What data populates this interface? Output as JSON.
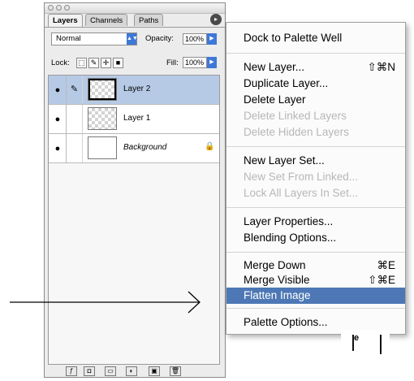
{
  "palette": {
    "tabs": [
      "Layers",
      "Channels",
      "Paths"
    ],
    "menu_button": "▸",
    "blend_mode": "Normal",
    "opacity_label": "Opacity:",
    "opacity_value": "100%",
    "lock_label": "Lock:",
    "fill_label": "Fill:",
    "fill_value": "100%",
    "layers": [
      {
        "name": "Layer 2",
        "selected": true
      },
      {
        "name": "Layer 1",
        "selected": false
      },
      {
        "name": "Background",
        "selected": false
      }
    ]
  },
  "menu": {
    "items": [
      {
        "label": "Dock to Palette Well",
        "shortcut": "",
        "disabled": false
      },
      {
        "label": "New Layer...",
        "shortcut": "⇧⌘N",
        "disabled": false
      },
      {
        "label": "Duplicate Layer...",
        "shortcut": "",
        "disabled": false
      },
      {
        "label": "Delete Layer",
        "shortcut": "",
        "disabled": false
      },
      {
        "label": "Delete Linked Layers",
        "shortcut": "",
        "disabled": true
      },
      {
        "label": "Delete Hidden Layers",
        "shortcut": "",
        "disabled": true
      },
      {
        "label": "New Layer Set...",
        "shortcut": "",
        "disabled": false
      },
      {
        "label": "New Set From Linked...",
        "shortcut": "",
        "disabled": true
      },
      {
        "label": "Lock All Layers In Set...",
        "shortcut": "",
        "disabled": true
      },
      {
        "label": "Layer Properties...",
        "shortcut": "",
        "disabled": false
      },
      {
        "label": "Blending Options...",
        "shortcut": "",
        "disabled": false
      },
      {
        "label": "Merge Down",
        "shortcut": "⌘E",
        "disabled": false
      },
      {
        "label": "Merge Visible",
        "shortcut": "⇧⌘E",
        "disabled": false
      },
      {
        "label": "Flatten Image",
        "shortcut": "",
        "disabled": false,
        "highlighted": true
      },
      {
        "label": "Palette Options...",
        "shortcut": "",
        "disabled": false
      }
    ],
    "highlight_color": "#4d78b5"
  },
  "doc_fragment_text": "e"
}
